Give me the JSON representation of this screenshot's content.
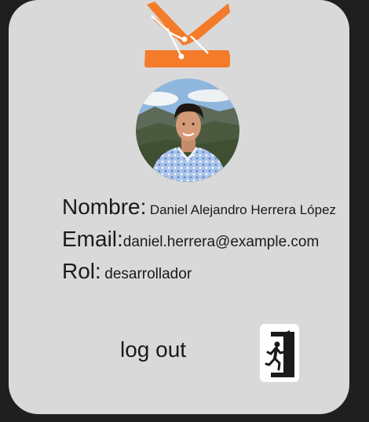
{
  "profile": {
    "name_label": "Nombre:",
    "name_value": "Daniel Alejandro Herrera López",
    "email_label": "Email:",
    "email_value": "daniel.herrera@example.com",
    "role_label": "Rol:",
    "role_value": "desarrollador"
  },
  "actions": {
    "logout_label": "log out"
  },
  "icons": {
    "logo": "brand-logo",
    "avatar": "profile-photo",
    "logout": "exit-door-icon"
  },
  "colors": {
    "card_background": "#d9d9d9",
    "brand_orange": "#f47b2a",
    "page_background": "#1f1f1f"
  }
}
